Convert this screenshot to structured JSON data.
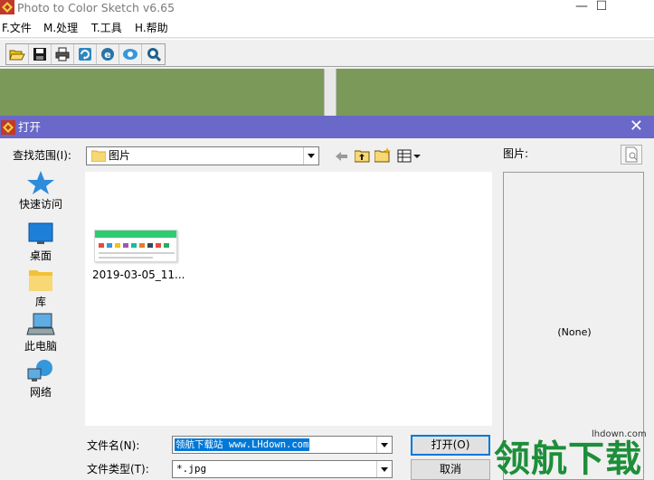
{
  "app": {
    "title": "Photo to Color Sketch v6.65",
    "minimize": "—",
    "maximize": "☐"
  },
  "menu": {
    "items": [
      "F.文件",
      "M.处理",
      "T.工具",
      "H.帮助"
    ]
  },
  "toolbar": {
    "buttons": [
      "open-folder-icon",
      "save-icon",
      "print-icon",
      "process-icon",
      "web-icon",
      "settings-icon",
      "help-icon"
    ]
  },
  "dialog": {
    "title": "打开",
    "close": "✕",
    "lookin_label": "查找范围(I):",
    "lookin_value": "图片",
    "places": [
      {
        "label": "快速访问",
        "icon": "star-icon"
      },
      {
        "label": "桌面",
        "icon": "desktop-icon"
      },
      {
        "label": "库",
        "icon": "library-icon"
      },
      {
        "label": "此电脑",
        "icon": "computer-icon"
      },
      {
        "label": "网络",
        "icon": "network-icon"
      }
    ],
    "files": [
      {
        "name": "2019-03-05_11..."
      }
    ],
    "preview_label": "图片:",
    "preview_value": "(None)",
    "filename_label": "文件名(N):",
    "filename_value": "领航下载站  www.LHdown.com",
    "filetype_label": "文件类型(T):",
    "filetype_value": "*.jpg",
    "open_button": "打开(O)",
    "cancel_button": "取消"
  },
  "watermark": {
    "site": "lhdown.com",
    "text": "领航下载"
  },
  "colors": {
    "dialog_title_bg": "#6a68c9",
    "panel_green": "#7b9a5a",
    "selection_blue": "#0078d7"
  }
}
